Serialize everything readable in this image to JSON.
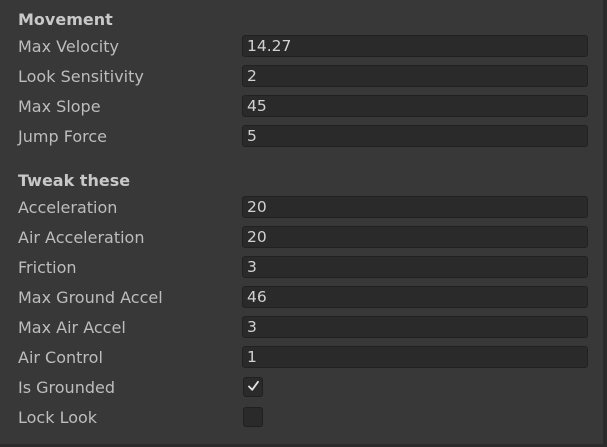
{
  "sections": {
    "movement": {
      "header": "Movement",
      "fields": [
        {
          "label": "Max Velocity",
          "value": "14.27"
        },
        {
          "label": "Look Sensitivity",
          "value": "2"
        },
        {
          "label": "Max Slope",
          "value": "45"
        },
        {
          "label": "Jump Force",
          "value": "5"
        }
      ]
    },
    "tweak": {
      "header": "Tweak these",
      "fields": [
        {
          "label": "Acceleration",
          "value": "20"
        },
        {
          "label": "Air Acceleration",
          "value": "20"
        },
        {
          "label": "Friction",
          "value": "3"
        },
        {
          "label": "Max Ground Accel",
          "value": "46"
        },
        {
          "label": "Max Air Accel",
          "value": "3"
        },
        {
          "label": "Air Control",
          "value": "1"
        }
      ],
      "toggles": [
        {
          "label": "Is Grounded",
          "checked": true
        },
        {
          "label": "Lock Look",
          "checked": false
        }
      ]
    }
  },
  "icons": {
    "check": "checkmark-icon"
  },
  "colors": {
    "background": "#383838",
    "field_background": "#2a2a2a",
    "text": "#c4c4c4"
  }
}
